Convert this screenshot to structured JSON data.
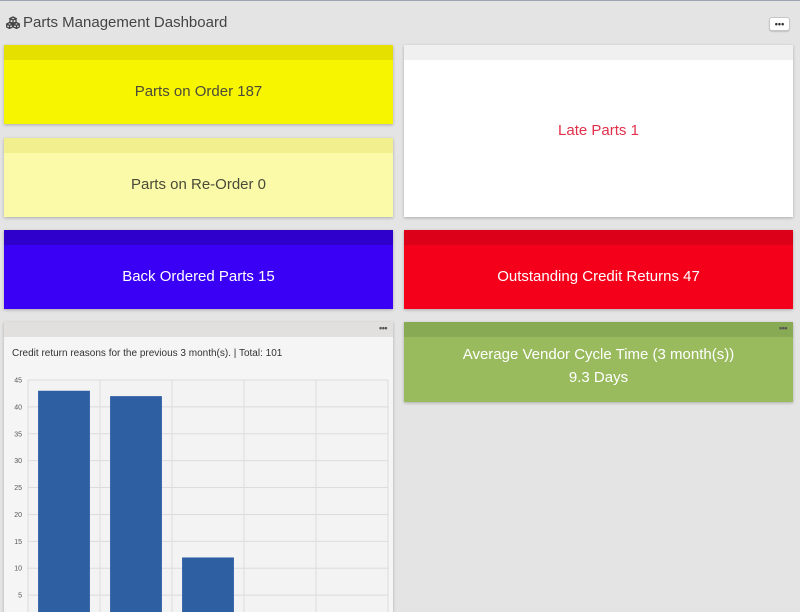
{
  "header": {
    "title": "Parts Management Dashboard",
    "icon": "cubes-icon",
    "more_label": "•••"
  },
  "tiles": {
    "parts_on_order": {
      "text": "Parts on Order 187",
      "color": "#f8f500"
    },
    "parts_on_reorder": {
      "text": "Parts on Re-Order 0",
      "color": "#fafaa8"
    },
    "late_parts": {
      "text": "Late Parts 1",
      "color": "#ffffff",
      "text_color": "#e2304a"
    },
    "back_ordered": {
      "text": "Back Ordered Parts 15",
      "color": "#3a00f5"
    },
    "credit_returns": {
      "text": "Outstanding Credit Returns 47",
      "color": "#f5001a"
    },
    "vendor_cycle": {
      "line1": "Average Vendor Cycle Time (3 month(s))",
      "line2": "9.3 Days",
      "color": "#99bb5e",
      "menu_label": "•••"
    }
  },
  "credit_chart": {
    "menu_label": "•••",
    "title": "Credit return reasons for the previous 3 month(s). | Total: 101"
  },
  "chart_data": {
    "type": "bar",
    "title": "Credit return reasons for the previous 3 month(s). | Total: 101",
    "categories": [
      "",
      "",
      "",
      "",
      ""
    ],
    "values": [
      43,
      42,
      12,
      null,
      null
    ],
    "ylim": [
      0,
      45
    ],
    "yticks": [
      5,
      10,
      15,
      20,
      25,
      30,
      35,
      40,
      45
    ],
    "grid": true,
    "bar_color": "#2e5fa3"
  }
}
